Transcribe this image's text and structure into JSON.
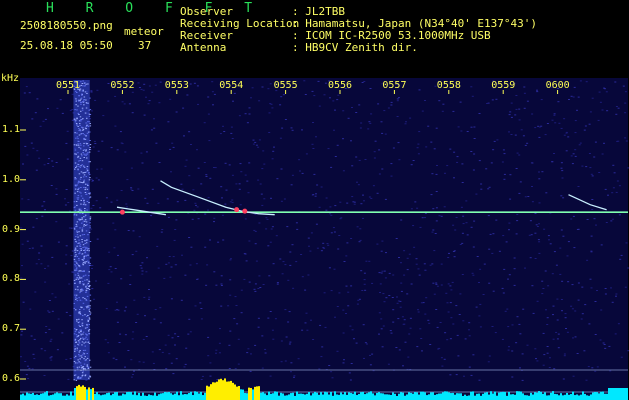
{
  "header": {
    "title": "H R O F F T",
    "filename": "2508180550.png",
    "datetime": "25.08.18 05:50",
    "count_label": "meteor",
    "count_value": "37",
    "keys": [
      "Observer",
      "Receiving Location",
      "Receiver",
      "Antenna"
    ],
    "values": [
      ": JL2TBB",
      ": Hamamatsu, Japan (N34°40' E137°43')",
      ": ICOM IC-R2500 53.1000MHz USB",
      ": HB9CV Zenith dir."
    ]
  },
  "chart_data": {
    "type": "heatmap",
    "ylabel": "kHz",
    "yticks": [
      "1.1",
      "1.0",
      "0.9",
      "0.8",
      "0.7",
      "0.6"
    ],
    "ytick_values": [
      1.1,
      1.0,
      0.9,
      0.8,
      0.7,
      0.6
    ],
    "xticks": [
      "0551",
      "0552",
      "0553",
      "0554",
      "0555",
      "0556",
      "0557",
      "0558",
      "0559",
      "0600"
    ],
    "xrange_minutes": [
      0,
      10
    ],
    "yrange_khz": [
      0.6,
      1.17
    ],
    "carrier_khz": 0.935,
    "noise_band_minutes": [
      0.1,
      0.4
    ],
    "echoes": [
      {
        "t": [
          1.7,
          1.9,
          2.4,
          2.9,
          3.2,
          3.5,
          3.8
        ],
        "f": [
          0.998,
          0.985,
          0.965,
          0.945,
          0.937,
          0.932,
          0.93
        ]
      },
      {
        "t": [
          0.9,
          1.2,
          1.5,
          1.8
        ],
        "f": [
          0.945,
          0.94,
          0.935,
          0.93
        ]
      },
      {
        "t": [
          9.2,
          9.4,
          9.6,
          9.9
        ],
        "f": [
          0.97,
          0.96,
          0.95,
          0.94
        ]
      }
    ],
    "colors": {
      "background": "#0a0a4a",
      "carrier": "#80ffb0",
      "echo": "#c8f0ff",
      "histogram": "#00e8ff",
      "histogram_peak": "#ffee00"
    }
  }
}
